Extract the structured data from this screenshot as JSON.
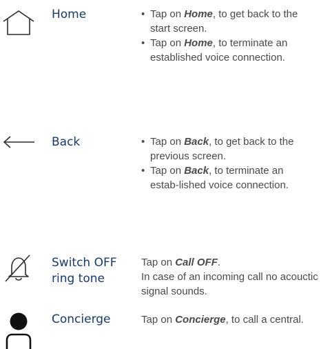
{
  "colors": {
    "label": "#1a3a66",
    "text": "#4a4a4a",
    "icon": "#2b2b2b"
  },
  "items": [
    {
      "icon": "home-icon",
      "label": "Home",
      "bullets": [
        {
          "pre": "Tap on ",
          "em": "Home",
          "post": ", to get back to the start screen."
        },
        {
          "pre": "Tap on ",
          "em": "Home",
          "post": ", to terminate an established voice connection."
        }
      ]
    },
    {
      "icon": "back-arrow-icon",
      "label": "Back",
      "bullets": [
        {
          "pre": "Tap on ",
          "em": "Back",
          "post": ", to get back to the previous screen."
        },
        {
          "pre": "Tap on ",
          "em": "Back",
          "post": ", to terminate an estab-lished voice connection."
        }
      ]
    },
    {
      "icon": "bell-off-icon",
      "label_line1": "Switch OFF",
      "label_line2": "ring tone",
      "line1_pre": "Tap on ",
      "line1_em": "Call OFF",
      "line1_post": ".",
      "line2": "In case of an incoming call no acouctic signal sounds."
    },
    {
      "icon": "person-icon",
      "label": "Concierge",
      "line1_pre": "Tap on ",
      "line1_em": "Concierge",
      "line1_post": ", to call a central."
    }
  ]
}
